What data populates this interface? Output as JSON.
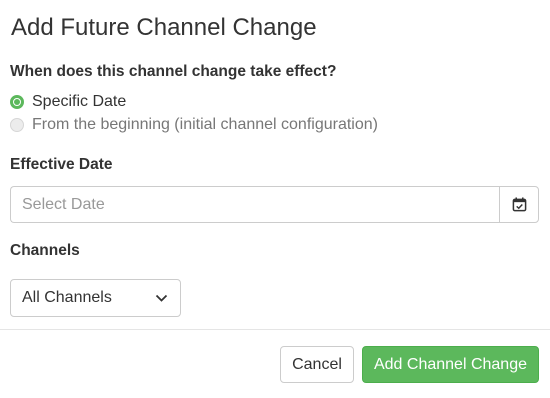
{
  "dialog": {
    "title": "Add Future Channel Change",
    "question": "When does this channel change take effect?",
    "options": [
      {
        "label": "Specific Date",
        "selected": true,
        "disabled": false
      },
      {
        "label": "From the beginning (initial channel configuration)",
        "selected": false,
        "disabled": true
      }
    ],
    "effective_date": {
      "label": "Effective Date",
      "value": "",
      "placeholder": "Select Date",
      "icon": "calendar-icon"
    },
    "channels": {
      "label": "Channels",
      "selected": "All Channels",
      "icon": "chevron-down-icon"
    },
    "footer": {
      "cancel_label": "Cancel",
      "submit_label": "Add Channel Change"
    },
    "colors": {
      "primary": "#5cb85c",
      "border": "#cccccc",
      "text": "#333333"
    }
  }
}
